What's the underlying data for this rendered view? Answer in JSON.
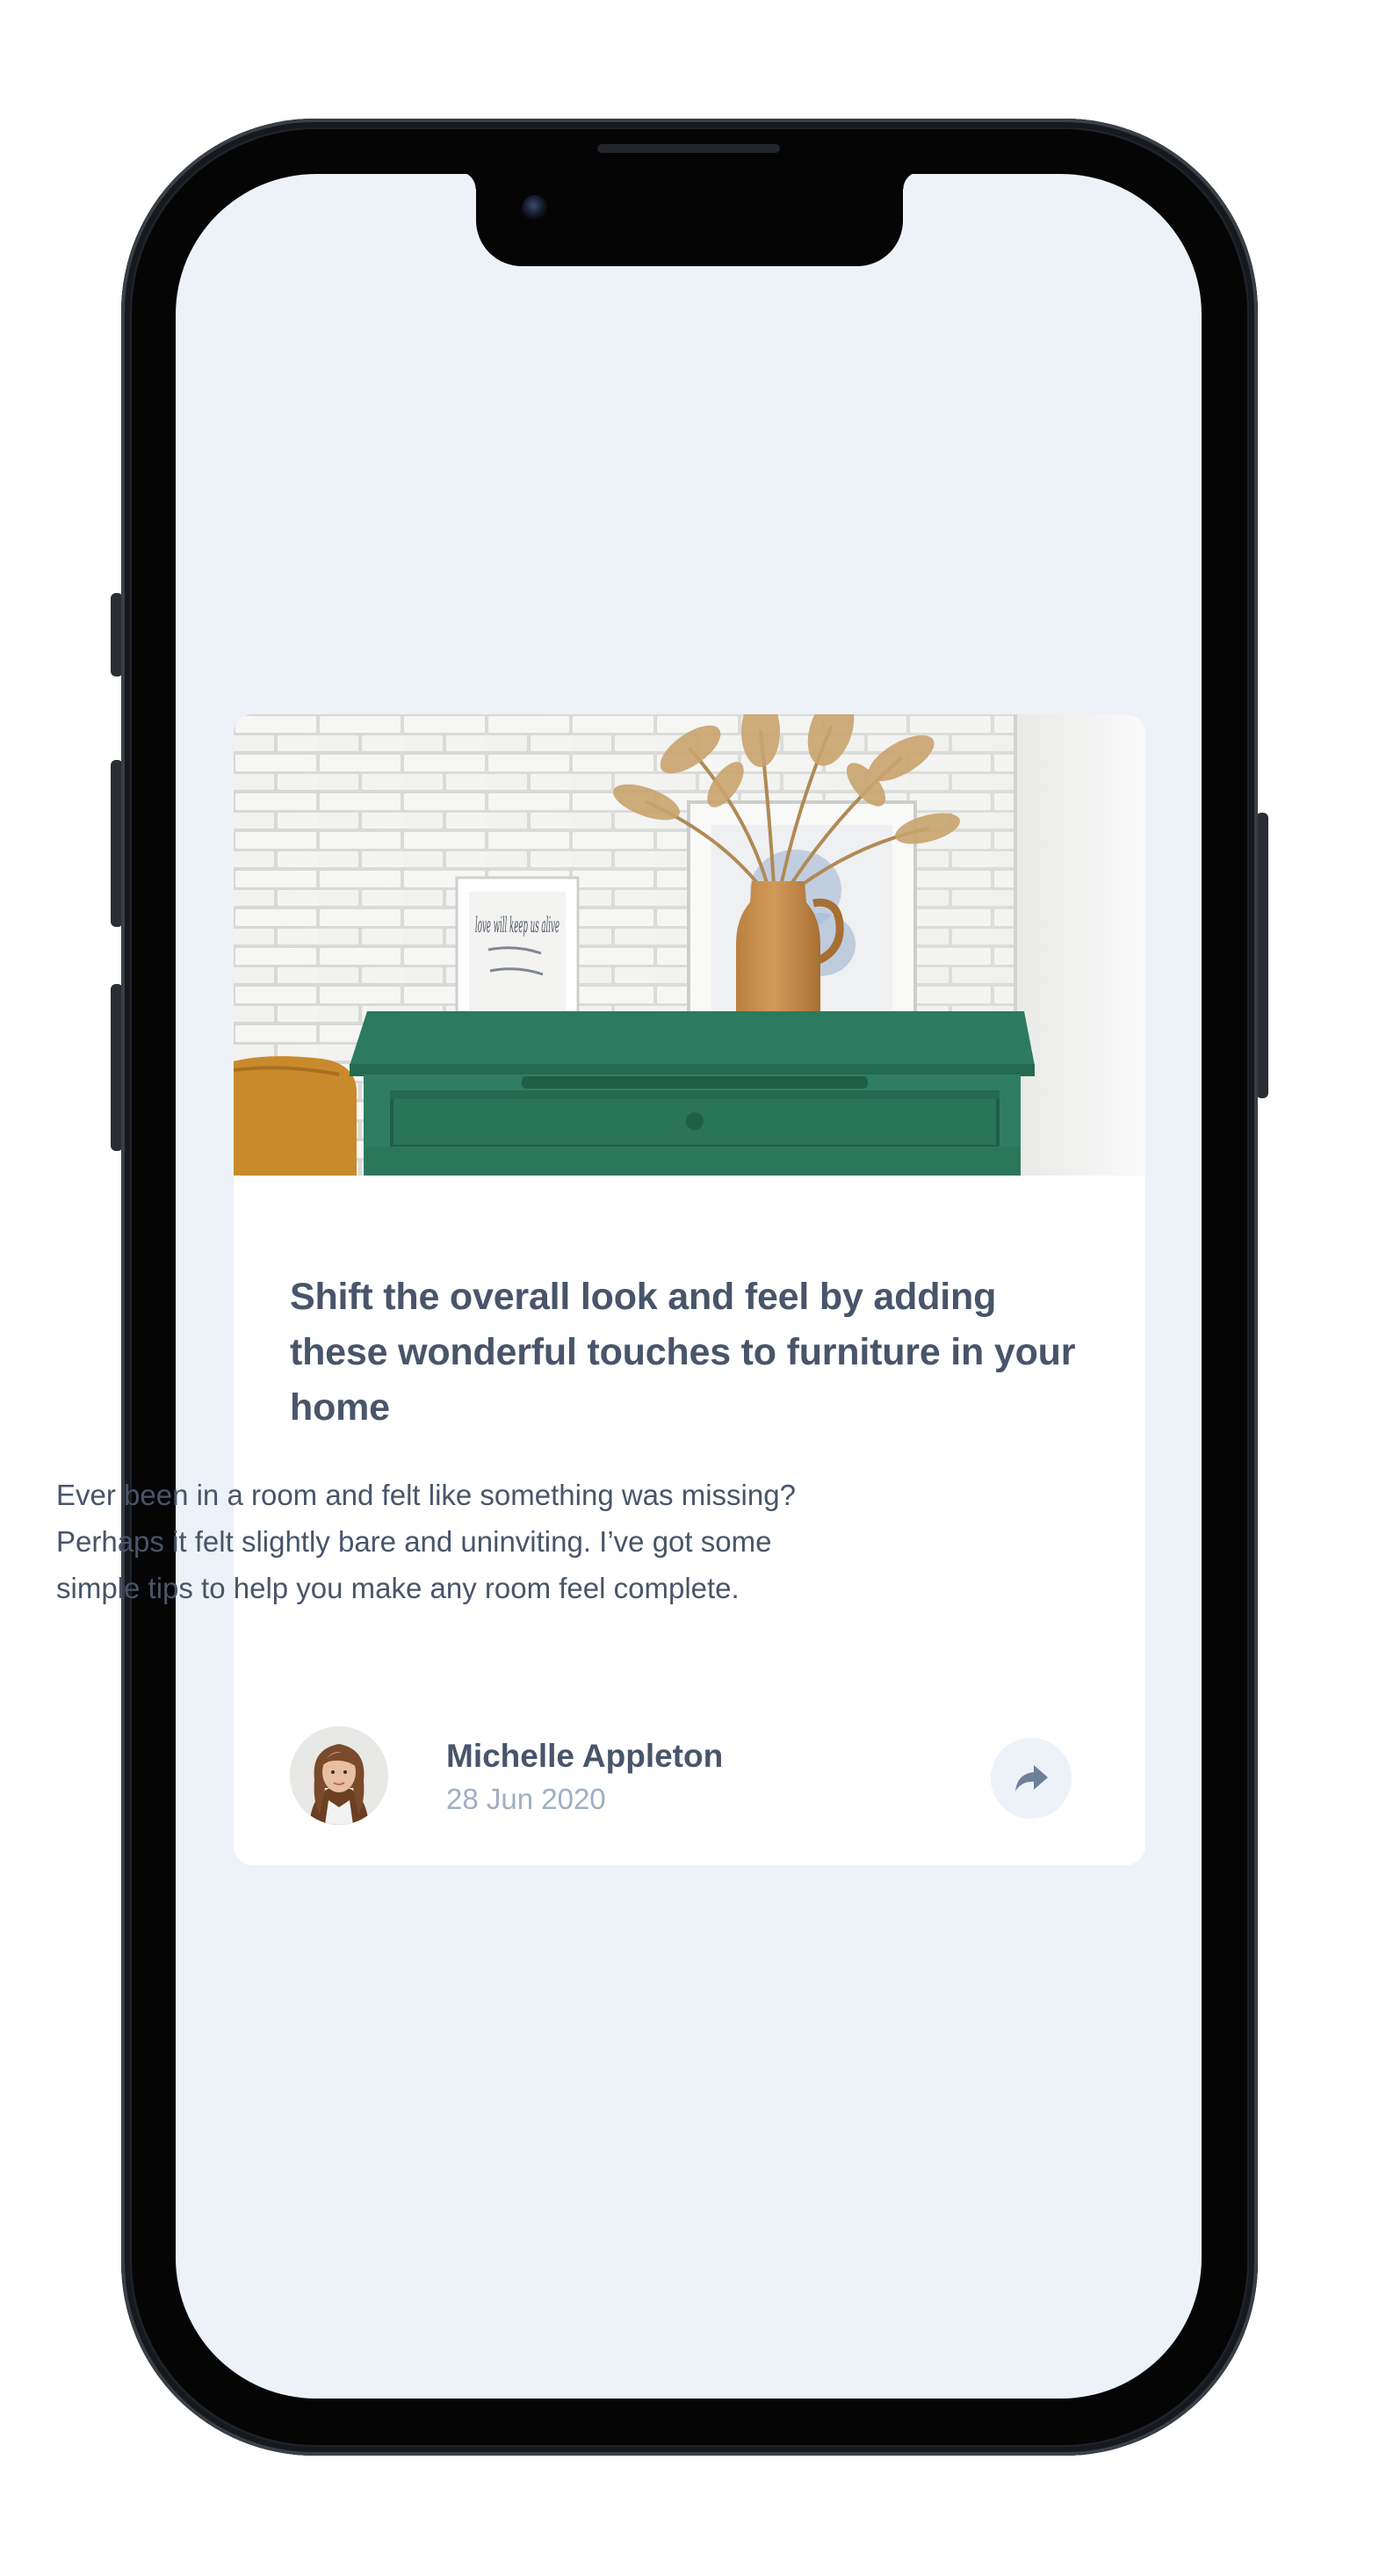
{
  "article": {
    "title": "Shift the overall look and feel by adding these wonderful touches to furniture in your home",
    "excerpt": "Ever been in a room and felt like something was missing? Perhaps it felt slightly bare and uninviting. I’ve got some simple tips to help you make any room feel complete.",
    "frame_print_text": "love will keep us alive"
  },
  "author": {
    "name": "Michelle Appleton",
    "date": "28 Jun 2020"
  },
  "share": {
    "icon": "share-icon"
  },
  "colors": {
    "page_background": "#ecf2f8",
    "card_background": "#ffffff",
    "title_text": "#48556a",
    "muted_text": "#9eafc2",
    "share_button_bg": "#ecf2f8",
    "share_icon": "#6e8098",
    "drawer_green": "#2c7a5f"
  }
}
